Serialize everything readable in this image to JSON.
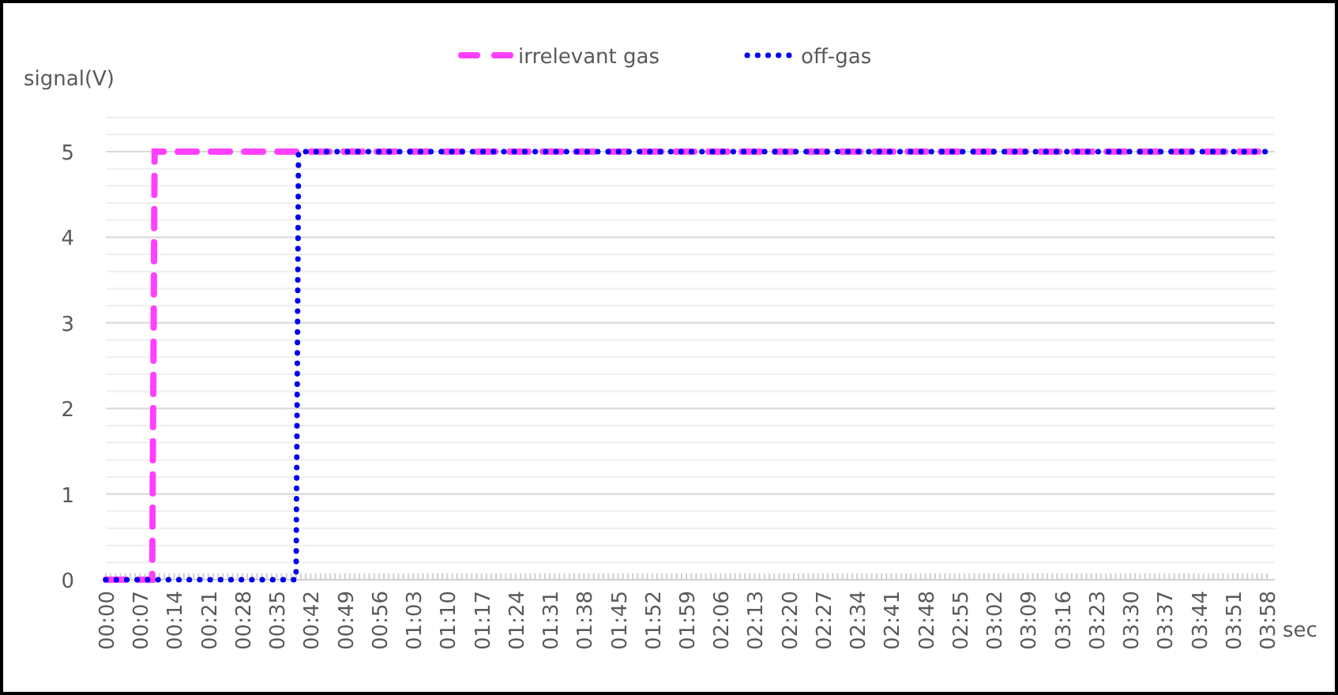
{
  "chart_data": {
    "type": "line",
    "ylabel": "signal(V)",
    "xlabel": "sec",
    "x": [
      0,
      9.5,
      10,
      39,
      39.5,
      238
    ],
    "series": [
      {
        "name": "irrelevant gas",
        "color": "#ff40ff",
        "line_style": "dashed",
        "values": [
          0,
          0,
          5,
          5,
          5,
          5
        ]
      },
      {
        "name": "off-gas",
        "color": "#0000ee",
        "line_style": "dotted",
        "values": [
          0,
          0,
          0,
          0,
          5,
          5
        ]
      }
    ],
    "grid": true,
    "legend": true,
    "xlim": [
      0,
      238
    ],
    "ylim": [
      0,
      5.4
    ],
    "yticks": [
      0,
      1,
      2,
      3,
      4,
      5
    ],
    "xticks": [
      {
        "value": 0,
        "label": "00:00"
      },
      {
        "value": 7,
        "label": "00:07"
      },
      {
        "value": 14,
        "label": "00:14"
      },
      {
        "value": 21,
        "label": "00:21"
      },
      {
        "value": 28,
        "label": "00:28"
      },
      {
        "value": 35,
        "label": "00:35"
      },
      {
        "value": 42,
        "label": "00:42"
      },
      {
        "value": 49,
        "label": "00:49"
      },
      {
        "value": 56,
        "label": "00:56"
      },
      {
        "value": 63,
        "label": "01:03"
      },
      {
        "value": 70,
        "label": "01:10"
      },
      {
        "value": 77,
        "label": "01:17"
      },
      {
        "value": 84,
        "label": "01:24"
      },
      {
        "value": 91,
        "label": "01:31"
      },
      {
        "value": 98,
        "label": "01:38"
      },
      {
        "value": 105,
        "label": "01:45"
      },
      {
        "value": 112,
        "label": "01:52"
      },
      {
        "value": 119,
        "label": "01:59"
      },
      {
        "value": 126,
        "label": "02:06"
      },
      {
        "value": 133,
        "label": "02:13"
      },
      {
        "value": 140,
        "label": "02:20"
      },
      {
        "value": 147,
        "label": "02:27"
      },
      {
        "value": 154,
        "label": "02:34"
      },
      {
        "value": 161,
        "label": "02:41"
      },
      {
        "value": 168,
        "label": "02:48"
      },
      {
        "value": 175,
        "label": "02:55"
      },
      {
        "value": 182,
        "label": "03:02"
      },
      {
        "value": 189,
        "label": "03:09"
      },
      {
        "value": 196,
        "label": "03:16"
      },
      {
        "value": 203,
        "label": "03:23"
      },
      {
        "value": 210,
        "label": "03:30"
      },
      {
        "value": 217,
        "label": "03:37"
      },
      {
        "value": 224,
        "label": "03:44"
      },
      {
        "value": 231,
        "label": "03:51"
      },
      {
        "value": 238,
        "label": "03:58"
      }
    ]
  }
}
